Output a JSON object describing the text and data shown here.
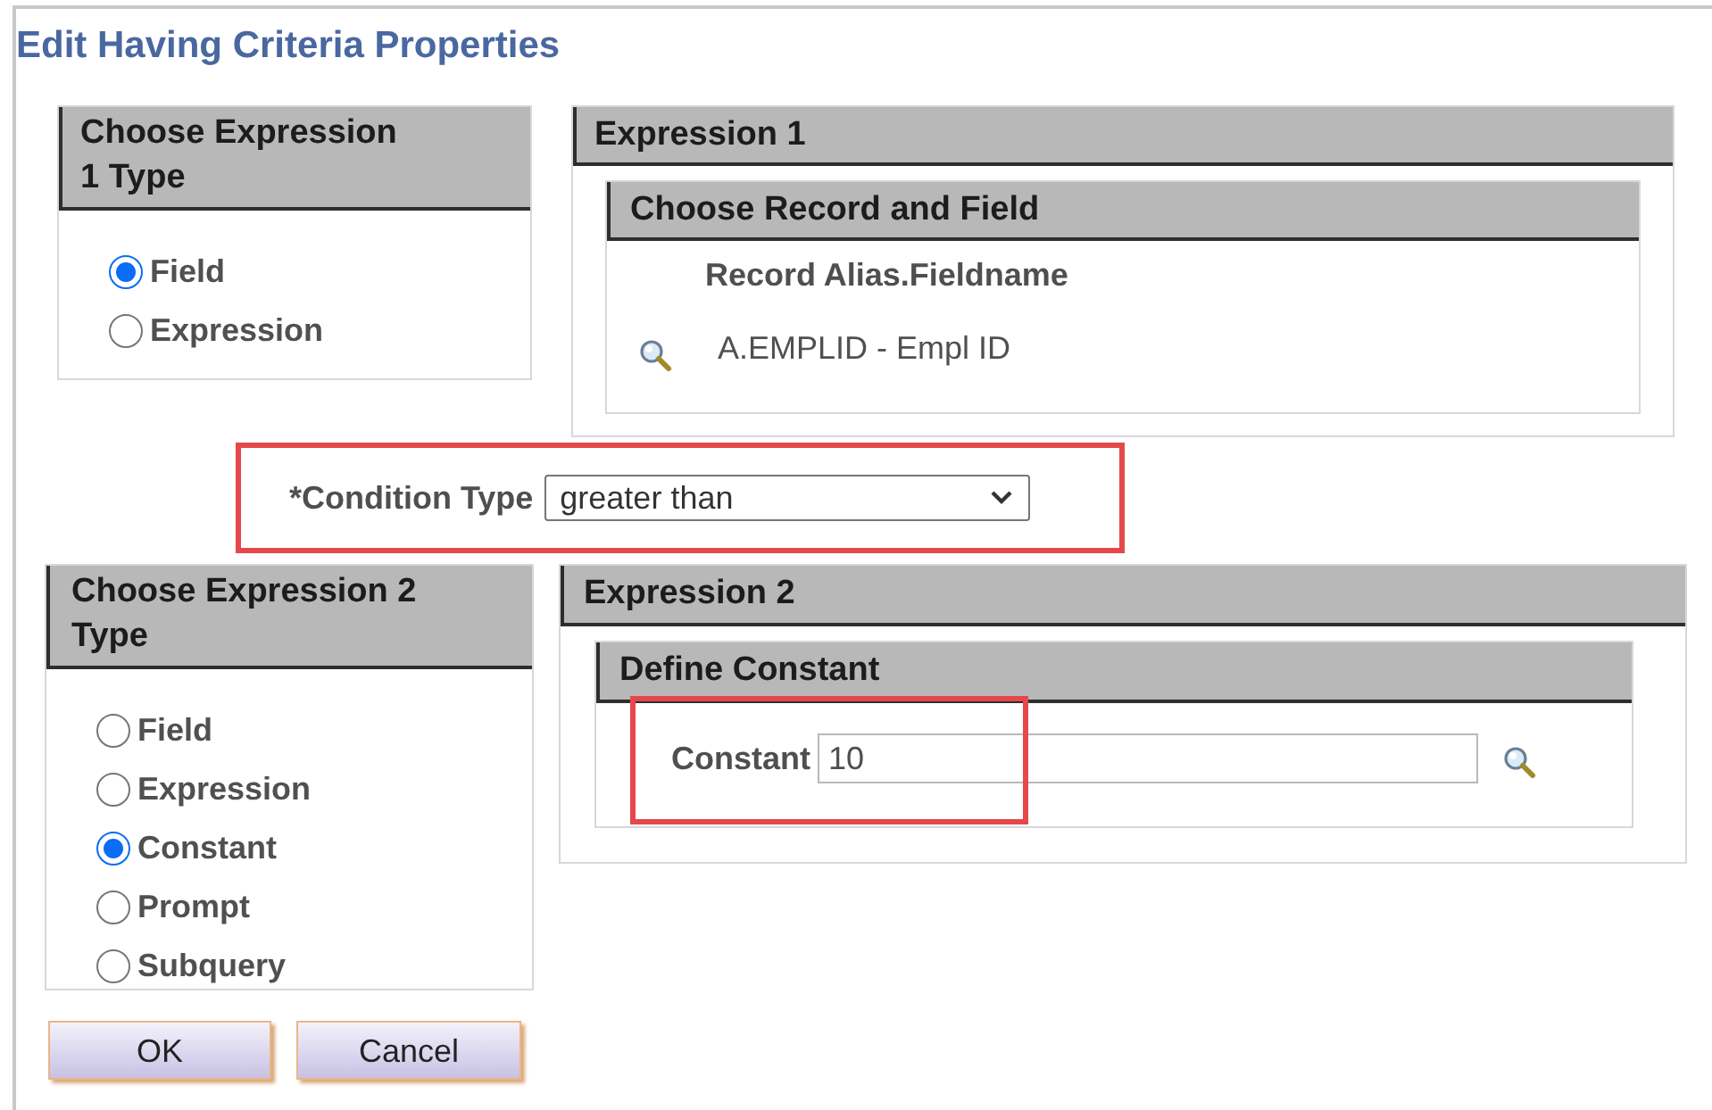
{
  "title": "Edit Having Criteria Properties",
  "expression1_type": {
    "heading": "Choose Expression 1 Type",
    "options": [
      {
        "label": "Field",
        "selected": true
      },
      {
        "label": "Expression",
        "selected": false
      }
    ]
  },
  "expression1": {
    "heading": "Expression 1",
    "group": {
      "heading": "Choose Record and Field",
      "column_header": "Record Alias.Fieldname",
      "value": "A.EMPLID - Empl ID"
    }
  },
  "condition_type": {
    "label": "*Condition Type",
    "value": "greater than",
    "highlighted": true
  },
  "expression2_type": {
    "heading": "Choose Expression 2 Type",
    "options": [
      {
        "label": "Field",
        "selected": false
      },
      {
        "label": "Expression",
        "selected": false
      },
      {
        "label": "Constant",
        "selected": true
      },
      {
        "label": "Prompt",
        "selected": false
      },
      {
        "label": "Subquery",
        "selected": false
      }
    ]
  },
  "expression2": {
    "heading": "Expression 2",
    "group": {
      "heading": "Define Constant",
      "label": "Constant",
      "value": "10",
      "highlighted": true
    }
  },
  "buttons": [
    "OK",
    "Cancel"
  ]
}
